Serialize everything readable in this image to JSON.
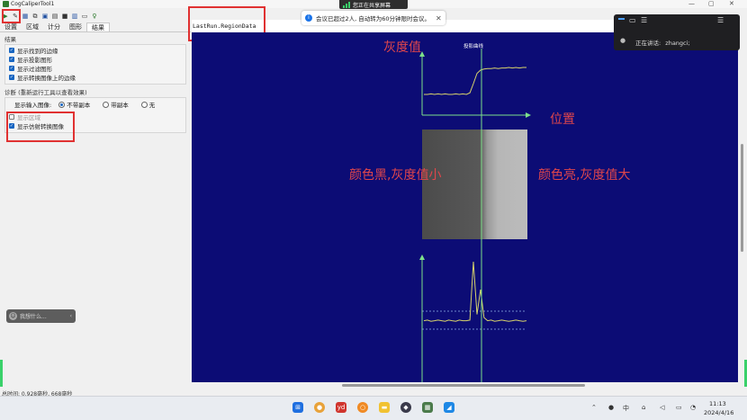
{
  "window": {
    "title": "CogCaliperTool1"
  },
  "share_banner": {
    "text": "您正在共享屏幕"
  },
  "toolbar": {
    "icons": [
      "play-icon",
      "edit-icon",
      "grid-icon",
      "copy-icon",
      "save-icon",
      "image-icon",
      "stop-icon",
      "chart-icon",
      "monitor-icon",
      "key-icon"
    ]
  },
  "tabs": [
    "设置",
    "区域",
    "计分",
    "图形",
    "结果"
  ],
  "panel": {
    "results_group_label": "结果",
    "result_checks": [
      {
        "label": "显示找到的边缘",
        "checked": true
      },
      {
        "label": "显示投影图形",
        "checked": true
      },
      {
        "label": "显示过滤图形",
        "checked": true
      },
      {
        "label": "显示转换图像上的边缘",
        "checked": true
      }
    ],
    "diag_group_label": "诊断 (重新运行工具以查看效果)",
    "input_image_label": "显示输入图像:",
    "input_image_options": [
      {
        "label": "不带副本",
        "selected": true
      },
      {
        "label": "带副本",
        "selected": false
      },
      {
        "label": "无",
        "selected": false
      }
    ],
    "diag_checks": [
      {
        "label": "显示区域",
        "checked": false
      },
      {
        "label": "显示仿射转换图像",
        "checked": true
      }
    ]
  },
  "ask_bubble": {
    "text": "我想什么..."
  },
  "status_line": "总时间: 0.928毫秒, 668毫秒",
  "viewer": {
    "region_label": "LastRun.RegionData",
    "profile_title": "投影曲线"
  },
  "notice": {
    "text": "会议已超过2人, 自动转为60分钟限时会议。"
  },
  "meeting": {
    "speaking_label": "正在讲话:",
    "speaker": "zhangci;"
  },
  "annotations": {
    "gray_value": "灰度值",
    "position": "位置",
    "dark_small": "颜色黑,灰度值小",
    "bright_large": "颜色亮,灰度值大"
  },
  "chart_data": {
    "type": "line",
    "title": "投影曲线",
    "series": [
      {
        "values": [
          0.35,
          0.35,
          0.36,
          0.35,
          0.36,
          0.35,
          0.36,
          0.35,
          0.35,
          0.36,
          0.35,
          0.36,
          0.35,
          0.38,
          0.55,
          0.74,
          0.8,
          0.82,
          0.83,
          0.83,
          0.84,
          0.83,
          0.84,
          0.84,
          0.85,
          0.84,
          0.85,
          0.84,
          0.85,
          0.85
        ]
      },
      {
        "values": [
          0.05,
          0.06,
          0.04,
          0.05,
          0.06,
          0.05,
          0.04,
          0.06,
          0.05,
          0.04,
          0.06,
          0.05,
          0.05,
          0.06,
          1.0,
          0.15,
          0.55,
          0.1,
          0.05,
          0.06,
          0.04,
          0.05,
          0.06,
          0.05,
          0.04,
          0.05,
          0.06,
          0.05,
          0.04,
          0.05
        ]
      }
    ]
  },
  "taskbar": {
    "apps": [
      "windows-icon",
      "search-icon",
      "chrome-icon",
      "yd-icon",
      "search-app-icon",
      "folder-icon",
      "game-icon",
      "app-icon",
      "media-icon",
      "meeting-icon"
    ],
    "ime": "中",
    "time": "11:13",
    "date": "2024/4/16"
  },
  "colors": {
    "viewer_bg": "#0c0c75",
    "annotation": "#e0464b",
    "curve": "#d8d36b",
    "axis": "#7de08a"
  }
}
